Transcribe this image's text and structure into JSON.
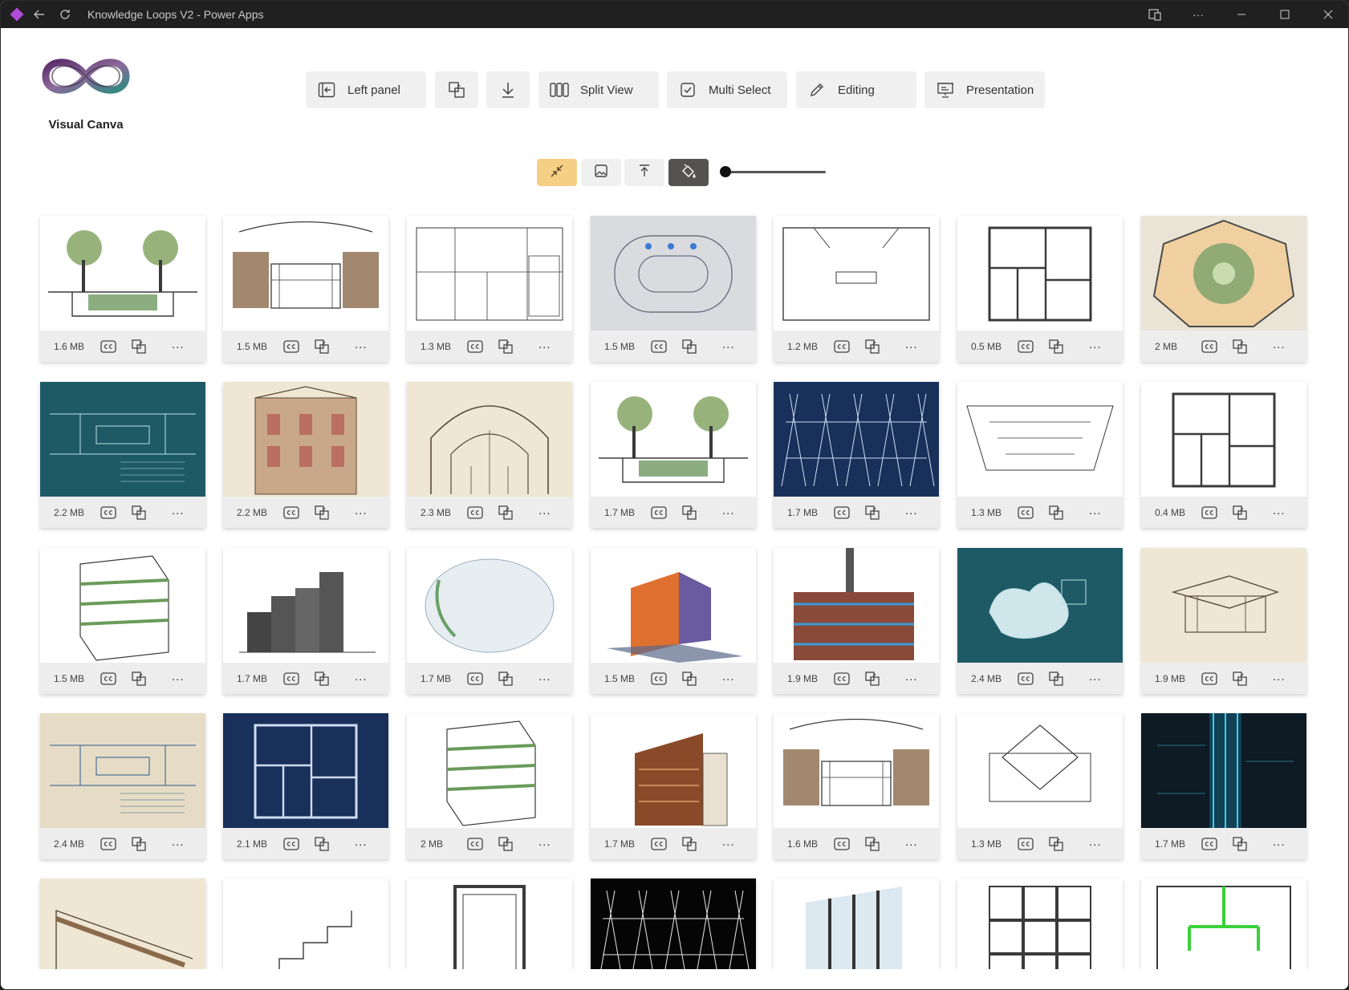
{
  "window": {
    "title": "Knowledge Loops V2 - Power Apps"
  },
  "app": {
    "name": "Visual Canva"
  },
  "toolbar": {
    "left_panel": "Left panel",
    "split_view": "Split View",
    "multi_select": "Multi Select",
    "editing": "Editing",
    "presentation": "Presentation"
  },
  "subtoolbar": {
    "zoom_slider_value": 0
  },
  "icons": {
    "left_panel": "panel-left-icon",
    "crop": "crop-icon",
    "download": "download-icon",
    "split_view": "columns-icon",
    "multi_select": "checkbox-icon",
    "editing": "pencil-icon",
    "presentation": "presentation-icon",
    "collapse": "shrink-icon",
    "image": "image-icon",
    "align_top": "align-top-icon",
    "fill": "paint-bucket-icon"
  },
  "colors": {
    "accent_yellow": "#f6cf86",
    "active_dark": "#555350",
    "card_footer": "#ededed"
  },
  "gallery": [
    {
      "size": "1.6 MB",
      "theme": "light",
      "kind": "section"
    },
    {
      "size": "1.5 MB",
      "theme": "light",
      "kind": "theater"
    },
    {
      "size": "1.3 MB",
      "theme": "light",
      "kind": "elevation"
    },
    {
      "size": "1.5 MB",
      "theme": "grey",
      "kind": "track"
    },
    {
      "size": "1.2 MB",
      "theme": "light",
      "kind": "plan"
    },
    {
      "size": "0.5 MB",
      "theme": "light",
      "kind": "floorplan"
    },
    {
      "size": "2 MB",
      "theme": "map",
      "kind": "hexmap"
    },
    {
      "size": "2.2 MB",
      "theme": "teal",
      "kind": "blueprint"
    },
    {
      "size": "2.2 MB",
      "theme": "beige",
      "kind": "facade"
    },
    {
      "size": "2.3 MB",
      "theme": "beige",
      "kind": "dome"
    },
    {
      "size": "1.7 MB",
      "theme": "light",
      "kind": "section"
    },
    {
      "size": "1.7 MB",
      "theme": "navy",
      "kind": "lattice"
    },
    {
      "size": "1.3 MB",
      "theme": "light",
      "kind": "ceiling"
    },
    {
      "size": "0.4 MB",
      "theme": "light",
      "kind": "floorplan"
    },
    {
      "size": "1.5 MB",
      "theme": "light",
      "kind": "tower"
    },
    {
      "size": "1.7 MB",
      "theme": "light",
      "kind": "blocks"
    },
    {
      "size": "1.7 MB",
      "theme": "light",
      "kind": "oval"
    },
    {
      "size": "1.5 MB",
      "theme": "light",
      "kind": "colorbox"
    },
    {
      "size": "1.9 MB",
      "theme": "light",
      "kind": "factory"
    },
    {
      "size": "2.4 MB",
      "theme": "teal",
      "kind": "pool"
    },
    {
      "size": "1.9 MB",
      "theme": "beige",
      "kind": "house"
    },
    {
      "size": "2.4 MB",
      "theme": "bluebeige",
      "kind": "blueprint"
    },
    {
      "size": "2.1 MB",
      "theme": "navy",
      "kind": "floorplan"
    },
    {
      "size": "2 MB",
      "theme": "light",
      "kind": "tower"
    },
    {
      "size": "1.7 MB",
      "theme": "light",
      "kind": "cabin"
    },
    {
      "size": "1.6 MB",
      "theme": "light",
      "kind": "theater"
    },
    {
      "size": "1.3 MB",
      "theme": "light",
      "kind": "roofplan"
    },
    {
      "size": "1.7 MB",
      "theme": "dark",
      "kind": "neon"
    },
    {
      "size": "",
      "theme": "beige",
      "kind": "roof"
    },
    {
      "size": "",
      "theme": "light",
      "kind": "stairs"
    },
    {
      "size": "",
      "theme": "light",
      "kind": "window"
    },
    {
      "size": "",
      "theme": "black",
      "kind": "lattice"
    },
    {
      "size": "",
      "theme": "light",
      "kind": "facadeglass"
    },
    {
      "size": "",
      "theme": "light",
      "kind": "grid"
    },
    {
      "size": "",
      "theme": "light",
      "kind": "greenplan"
    }
  ]
}
